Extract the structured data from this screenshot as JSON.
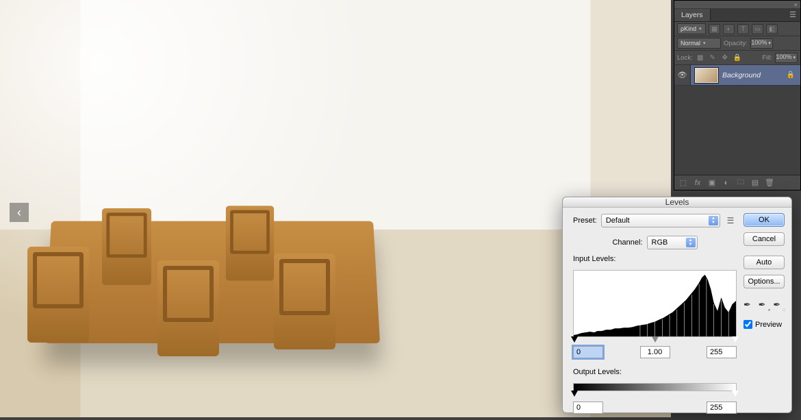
{
  "canvas": {
    "nav_left": "‹"
  },
  "layers_panel": {
    "title": "Layers",
    "filter_label": "Kind",
    "blend_mode": "Normal",
    "opacity_label": "Opacity:",
    "opacity_value": "100%",
    "lock_label": "Lock:",
    "fill_label": "Fill:",
    "fill_value": "100%",
    "layers": [
      {
        "name": "Background",
        "visible": true,
        "locked": true
      }
    ]
  },
  "levels_dialog": {
    "title": "Levels",
    "preset_label": "Preset:",
    "preset_value": "Default",
    "channel_label": "Channel:",
    "channel_value": "RGB",
    "input_levels_label": "Input Levels:",
    "input_black": "0",
    "input_gamma": "1.00",
    "input_white": "255",
    "output_levels_label": "Output Levels:",
    "output_black": "0",
    "output_white": "255",
    "buttons": {
      "ok": "OK",
      "cancel": "Cancel",
      "auto": "Auto",
      "options": "Options..."
    },
    "preview_label": "Preview",
    "preview_checked": true
  }
}
